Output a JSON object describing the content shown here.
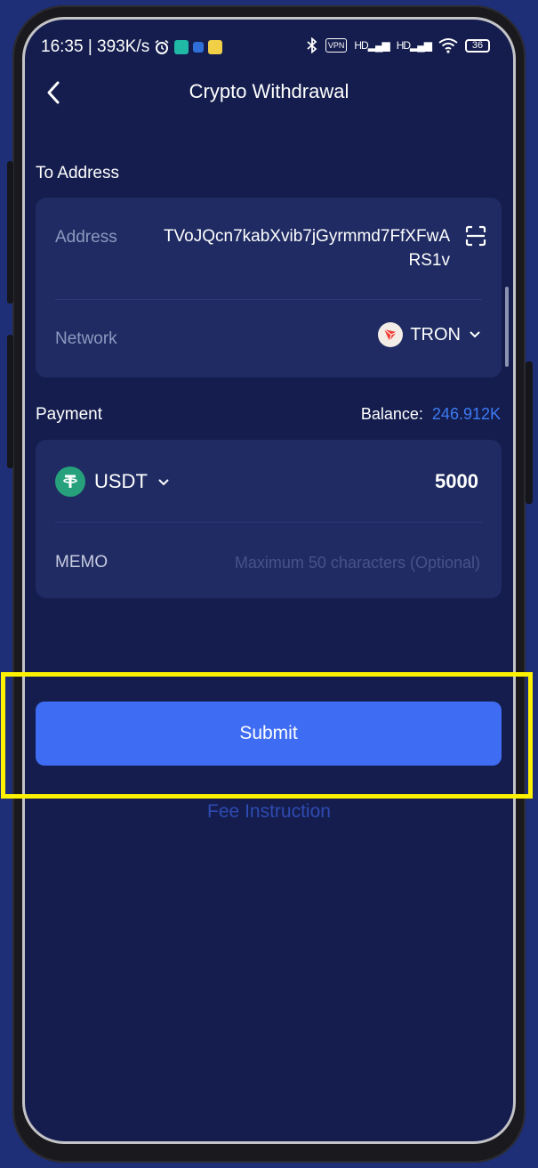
{
  "status_bar": {
    "time_speed": "16:35 | 393K/s",
    "vpn": "VPN",
    "signal_1": "HD",
    "signal_2": "HD",
    "battery": "36"
  },
  "header": {
    "title": "Crypto Withdrawal"
  },
  "to_address": {
    "section_label": "To Address",
    "address_label": "Address",
    "address_value": "TVoJQcn7kabXvib7jGyrmmd7FfXFwARS1v",
    "network_label": "Network",
    "network_value": "TRON"
  },
  "payment": {
    "section_label": "Payment",
    "balance_label": "Balance:",
    "balance_value": "246.912K",
    "token": "USDT",
    "amount": "5000",
    "memo_label": "MEMO",
    "memo_placeholder": "Maximum 50 characters (Optional)"
  },
  "actions": {
    "submit_label": "Submit",
    "fee_instruction": "Fee Instruction"
  },
  "colors": {
    "background": "#1e2f78",
    "screen": "#141d4d",
    "card": "#1f2b62",
    "accent": "#3e6cf2",
    "balance": "#3d7cf5",
    "highlight": "#fff200",
    "usdt": "#26a17b",
    "tron": "#ef3f36"
  },
  "icons": {
    "back": "back-arrow-icon",
    "scan": "scan-icon",
    "network": "tron-logo-icon",
    "token": "usdt-logo-icon",
    "dropdown": "chevron-down-icon"
  }
}
